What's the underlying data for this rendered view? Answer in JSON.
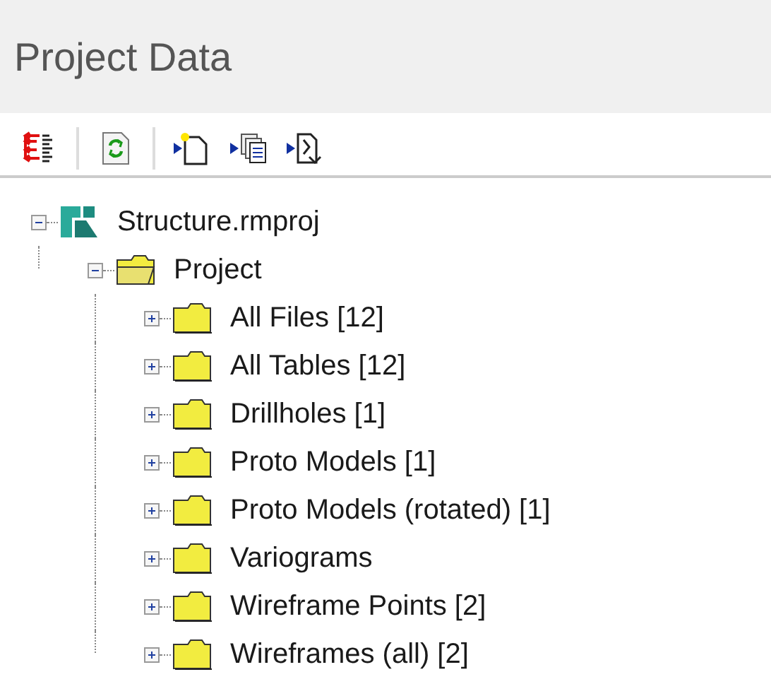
{
  "panel": {
    "title": "Project Data"
  },
  "toolbar": [
    {
      "kind": "collapse"
    },
    {
      "kind": "separator"
    },
    {
      "kind": "refresh"
    },
    {
      "kind": "separator"
    },
    {
      "kind": "new"
    },
    {
      "kind": "copy"
    },
    {
      "kind": "import"
    }
  ],
  "tree": [
    {
      "label": "Structure.rmproj",
      "kind": "project",
      "expanded": true,
      "children": [
        {
          "label": "Project",
          "kind": "folder",
          "expanded": true,
          "children": [
            {
              "label": "All Files [12]",
              "kind": "folder",
              "expanded": false
            },
            {
              "label": "All Tables [12]",
              "kind": "folder",
              "expanded": false
            },
            {
              "label": "Drillholes [1]",
              "kind": "folder",
              "expanded": false
            },
            {
              "label": "Proto Models [1]",
              "kind": "folder",
              "expanded": false
            },
            {
              "label": "Proto Models (rotated) [1]",
              "kind": "folder",
              "expanded": false
            },
            {
              "label": "Variograms",
              "kind": "folder",
              "expanded": false
            },
            {
              "label": "Wireframe Points [2]",
              "kind": "folder",
              "expanded": false
            },
            {
              "label": "Wireframes (all) [2]",
              "kind": "folder",
              "expanded": false
            }
          ]
        }
      ]
    }
  ]
}
